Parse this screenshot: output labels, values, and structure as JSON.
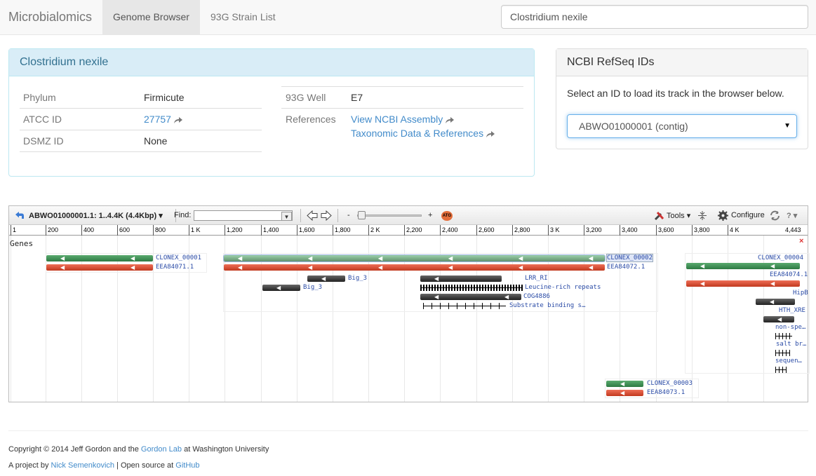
{
  "nav": {
    "brand": "Microbialomics",
    "tabs": [
      "Genome Browser",
      "93G Strain List"
    ],
    "search_value": "Clostridium nexile"
  },
  "organism": {
    "title": "Clostridium nexile",
    "left_rows": [
      {
        "label": "Phylum",
        "value": "Firmicute"
      },
      {
        "label": "ATCC ID",
        "value": "27757"
      },
      {
        "label": "DSMZ ID",
        "value": "None"
      }
    ],
    "right_rows": [
      {
        "label": "93G Well",
        "value": "E7"
      },
      {
        "label": "References",
        "links": [
          "View NCBI Assembly",
          "Taxonomic Data & References"
        ]
      }
    ]
  },
  "refseq": {
    "title": "NCBI RefSeq IDs",
    "instruction": "Select an ID to load its track in the browser below.",
    "selected": "ABWO01000001 (contig)"
  },
  "browser": {
    "location": "ABWO01000001.1: 1..4.4K (4.4Kbp)",
    "find_label": "Find:",
    "zoom_minus": "-",
    "zoom_plus": "+",
    "tools": "Tools",
    "configure": "Configure",
    "help": "?",
    "track_name": "Genes",
    "ruler_ticks": [
      "1",
      "200",
      "400",
      "600",
      "800",
      "1 K",
      "1,200",
      "1,400",
      "1,600",
      "1,800",
      "2 K",
      "2,200",
      "2,400",
      "2,600",
      "2,800",
      "3 K",
      "3,200",
      "3,400",
      "3,600",
      "3,800",
      "4 K",
      "4,443"
    ],
    "features": [
      {
        "name": "CLONEX_00001",
        "type": "gene"
      },
      {
        "name": "EEA84071.1",
        "type": "cds"
      },
      {
        "name": "CLONEX_00002",
        "type": "gene"
      },
      {
        "name": "EEA84072.1",
        "type": "cds"
      },
      {
        "name": "Big_3",
        "type": "domain"
      },
      {
        "name": "Big_3",
        "type": "domain"
      },
      {
        "name": "LRR_RI",
        "type": "domain"
      },
      {
        "name": "Leucine-rich repeats",
        "type": "domain"
      },
      {
        "name": "COG4886",
        "type": "domain"
      },
      {
        "name": "Substrate binding s…",
        "type": "domain"
      },
      {
        "name": "CLONEX_00004",
        "type": "gene"
      },
      {
        "name": "EEA84074.1",
        "type": "cds"
      },
      {
        "name": "HipB",
        "type": "domain"
      },
      {
        "name": "HTH_XRE",
        "type": "domain"
      },
      {
        "name": "non-spe…",
        "type": "site"
      },
      {
        "name": "salt br…",
        "type": "site"
      },
      {
        "name": "sequen…",
        "type": "site"
      },
      {
        "name": "CLONEX_00003",
        "type": "gene"
      },
      {
        "name": "EEA84073.1",
        "type": "cds"
      }
    ]
  },
  "footer": {
    "line1_prefix": "Copyright © 2014 Jeff Gordon and the ",
    "line1_link": "Gordon Lab",
    "line1_suffix": " at Washington University",
    "line2_prefix": "A project by ",
    "line2_link1": "Nick Semenkovich",
    "line2_mid": " | Open source at ",
    "line2_link2": "GitHub"
  },
  "colors": {
    "gene": "#3d8c52",
    "cds": "#d9472b",
    "domain": "#333333",
    "link": "#428bca"
  }
}
